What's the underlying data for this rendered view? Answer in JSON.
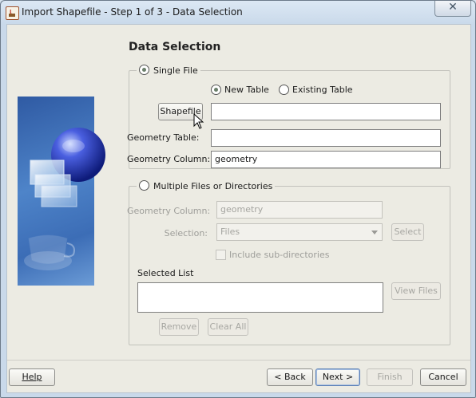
{
  "window": {
    "title": "Import Shapefile - Step 1 of 3 - Data Selection",
    "close_symbol": "✕"
  },
  "heading": "Data Selection",
  "single_file": {
    "legend": "Single File",
    "selected": true,
    "new_table_label": "New Table",
    "existing_table_label": "Existing Table",
    "table_mode": "New Table",
    "shapefile_button": "Shapefile",
    "shapefile_value": "",
    "geometry_table_label": "Geometry Table:",
    "geometry_table_value": "",
    "geometry_column_label": "Geometry Column:",
    "geometry_column_value": "geometry"
  },
  "multiple": {
    "legend": "Multiple Files or Directories",
    "selected": false,
    "geometry_column_label": "Geometry Column:",
    "geometry_column_placeholder": "geometry",
    "selection_label": "Selection:",
    "selection_value": "Files",
    "select_button": "Select",
    "include_subdirs_label": "Include sub-directories",
    "selected_list_label": "Selected List",
    "view_files_button": "View Files",
    "remove_button": "Remove",
    "clear_all_button": "Clear All"
  },
  "footer": {
    "help": "Help",
    "back": "< Back",
    "next": "Next >",
    "finish": "Finish",
    "cancel": "Cancel"
  },
  "icons": [
    "app-icon",
    "close-icon",
    "wizard-globe-illustration",
    "mouse-pointer-icon",
    "dropdown-arrow-icon"
  ]
}
